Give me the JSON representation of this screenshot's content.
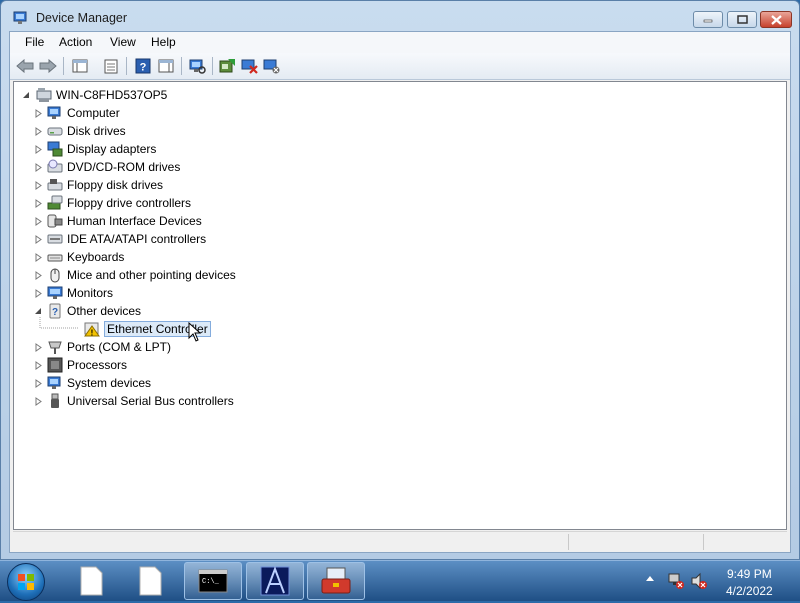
{
  "window": {
    "title": "Device Manager"
  },
  "menu": [
    "File",
    "Action",
    "View",
    "Help"
  ],
  "tree": {
    "root": "WIN-C8FHD537OP5",
    "categories": [
      "Computer",
      "Disk drives",
      "Display adapters",
      "DVD/CD-ROM drives",
      "Floppy disk drives",
      "Floppy drive controllers",
      "Human Interface Devices",
      "IDE ATA/ATAPI controllers",
      "Keyboards",
      "Mice and other pointing devices",
      "Monitors",
      "Other devices",
      "Ports (COM & LPT)",
      "Processors",
      "System devices",
      "Universal Serial Bus controllers"
    ],
    "other_devices_child": "Ethernet Controller"
  },
  "taskbar": {
    "time": "9:49 PM",
    "date": "4/2/2022"
  },
  "colors": {
    "accent": "#1e6fb8",
    "selection": "#dceaf8",
    "warning": "#f2c200",
    "close": "#c7412c"
  }
}
